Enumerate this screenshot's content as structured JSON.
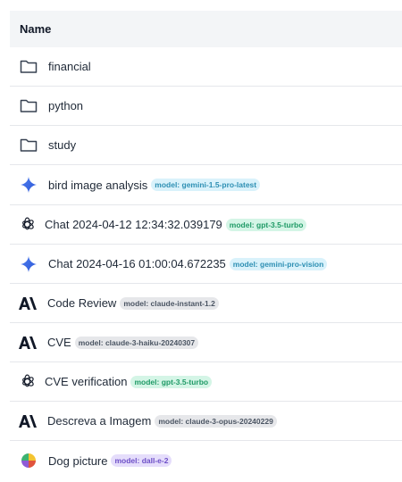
{
  "header": {
    "name_label": "Name"
  },
  "model_prefix": "model:",
  "rows": [
    {
      "icon": "folder-icon",
      "name": "financial",
      "model": ""
    },
    {
      "icon": "folder-icon",
      "name": "python",
      "model": ""
    },
    {
      "icon": "folder-icon",
      "name": "study",
      "model": ""
    },
    {
      "icon": "gemini-icon",
      "name": "bird image analysis",
      "model": "model: gemini-1.5-pro-latest",
      "badge": "gemini"
    },
    {
      "icon": "openai-icon",
      "name": "Chat 2024-04-12 12:34:32.039179",
      "model": "model: gpt-3.5-turbo",
      "badge": "openai"
    },
    {
      "icon": "gemini-icon",
      "name": "Chat 2024-04-16 01:00:04.672235",
      "model": "model: gemini-pro-vision",
      "badge": "gemini"
    },
    {
      "icon": "anthropic-icon",
      "name": "Code Review",
      "model": "model: claude-instant-1.2",
      "badge": "claude"
    },
    {
      "icon": "anthropic-icon",
      "name": "CVE",
      "model": "model: claude-3-haiku-20240307",
      "badge": "claude"
    },
    {
      "icon": "openai-icon",
      "name": "CVE verification",
      "model": "model: gpt-3.5-turbo",
      "badge": "openai"
    },
    {
      "icon": "anthropic-icon",
      "name": "Descreva a Imagem",
      "model": "model: claude-3-opus-20240229",
      "badge": "claude"
    },
    {
      "icon": "dalle-icon",
      "name": "Dog picture",
      "model": "model: dall-e-2",
      "badge": "dalle"
    }
  ],
  "colors": {
    "header_bg": "#f3f5f7",
    "divider": "#e5e7eb",
    "gemini_accent": "#3b82f6",
    "openai_badge": "#d4f5e6",
    "claude_badge": "#e6e7ea",
    "dalle_badge": "#e5ddfb"
  }
}
